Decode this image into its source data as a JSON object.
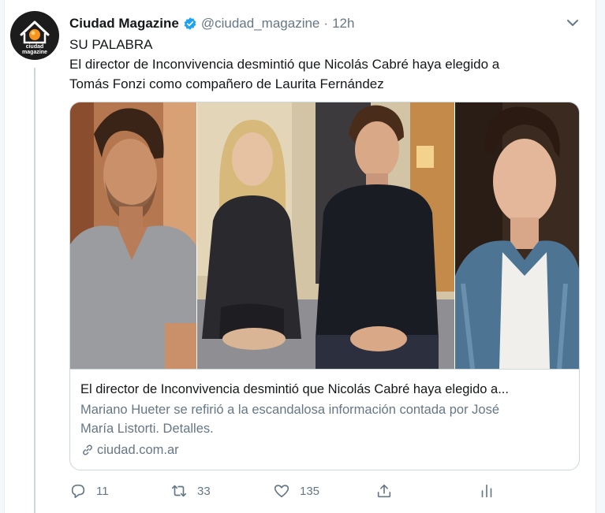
{
  "tweet": {
    "author_name": "Ciudad Magazine",
    "handle": "@ciudad_magazine",
    "separator": "·",
    "time": "12h",
    "avatar_text": [
      "ciudad",
      "magazine"
    ],
    "text_lines": [
      "SU PALABRA",
      "El director de Inconvivencia desmintió que Nicolás Cabré haya elegido a",
      "Tomás Fonzi como compañero de Laurita Fernández"
    ]
  },
  "card": {
    "title": "El director de Inconvivencia desmintió que Nicolás Cabré haya elegido a...",
    "description_lines": [
      "Mariano Hueter se refirió a la escandalosa información contada por José",
      "María Listorti. Detalles."
    ],
    "domain": "ciudad.com.ar",
    "domain_icon": "link-icon"
  },
  "actions": {
    "reply": {
      "icon": "reply-icon",
      "count": "11"
    },
    "retweet": {
      "icon": "retweet-icon",
      "count": "33"
    },
    "like": {
      "icon": "heart-icon",
      "count": "135"
    },
    "share": {
      "icon": "share-icon"
    },
    "analytics": {
      "icon": "analytics-icon"
    }
  },
  "colors": {
    "text_primary": "#14171a",
    "text_secondary": "#657786",
    "verified_blue": "#1da1f2",
    "border": "#ccd6dd",
    "avatar_orange": "#f7941d"
  }
}
